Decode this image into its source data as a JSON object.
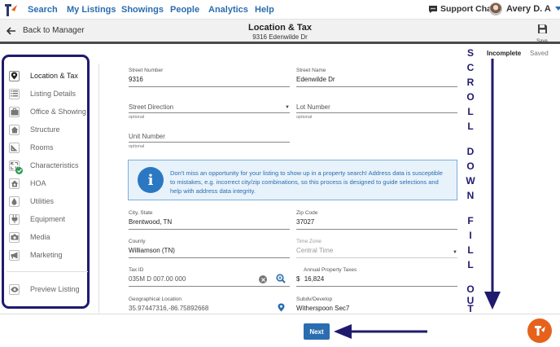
{
  "topnav": {
    "items": [
      "Search",
      "My Listings",
      "Showings",
      "People",
      "Analytics",
      "Help"
    ],
    "support_chat": "Support Chat",
    "user_name": "Avery D. A"
  },
  "header": {
    "back_label": "Back to Manager",
    "title": "Location & Tax",
    "subtitle": "9316 Edenwilde Dr",
    "save_label": "Save"
  },
  "status": {
    "incomplete": "Incomplete",
    "saved": "Saved"
  },
  "sidebar": {
    "items": [
      {
        "label": "Location & Tax",
        "icon": "map-pin-icon",
        "active": true
      },
      {
        "label": "Listing Details",
        "icon": "list-icon"
      },
      {
        "label": "Office & Showing",
        "icon": "briefcase-icon"
      },
      {
        "label": "Structure",
        "icon": "house-icon"
      },
      {
        "label": "Rooms",
        "icon": "ruler-triangle-icon"
      },
      {
        "label": "Characteristics",
        "icon": "expand-icon",
        "check": true
      },
      {
        "label": "HOA",
        "icon": "hoa-house-icon"
      },
      {
        "label": "Utilities",
        "icon": "drop-icon"
      },
      {
        "label": "Equipment",
        "icon": "plug-icon"
      },
      {
        "label": "Media",
        "icon": "camera-icon"
      },
      {
        "label": "Marketing",
        "icon": "megaphone-icon"
      }
    ],
    "preview_label": "Preview Listing"
  },
  "form": {
    "street_number": {
      "label": "Street Number",
      "value": "9316"
    },
    "street_name": {
      "label": "Street Name",
      "value": "Edenwilde Dr"
    },
    "street_direction": {
      "placeholder": "Street Direction",
      "hint": "optional"
    },
    "lot_number": {
      "placeholder": "Lot Number",
      "hint": "optional"
    },
    "unit_number": {
      "placeholder": "Unit Number",
      "hint": "optional"
    },
    "info_text": "Don't miss an opportunity for your listing to show up in a property search! Address data is susceptible to mistakes, e.g. incorrect city/zip combinations, so this process is designed to guide selections and help with address data integrity.",
    "city_state": {
      "label": "City, State",
      "value": "Brentwood, TN"
    },
    "zip_code": {
      "label": "Zip Code",
      "value": "37027"
    },
    "county": {
      "label": "County",
      "value": "Williamson (TN)"
    },
    "time_zone": {
      "label": "Time Zone",
      "value": "Central Time"
    },
    "tax_id": {
      "label": "Tax ID",
      "value": "035M D 007.00 000"
    },
    "annual_taxes": {
      "label": "Annual Property Taxes",
      "currency": "$",
      "value": "16,824"
    },
    "geo_location": {
      "label": "Geographical Location",
      "value": "35.97447316,-86.75892668"
    },
    "subdivision": {
      "label": "Subdv/Develop",
      "value": "Witherspoon Sec7"
    }
  },
  "annotation": {
    "letters": [
      "S",
      "C",
      "R",
      "O",
      "L",
      "L",
      "D",
      "O",
      "W",
      "N",
      "F",
      "I",
      "L",
      "L",
      "O",
      "U",
      "T"
    ],
    "color": "#1f1a6e"
  },
  "footer": {
    "next_label": "Next"
  },
  "colors": {
    "brand_blue": "#2a6db0",
    "annotation_navy": "#1f1a6e",
    "fab_orange": "#e6621c",
    "check_green": "#2f9a57"
  }
}
